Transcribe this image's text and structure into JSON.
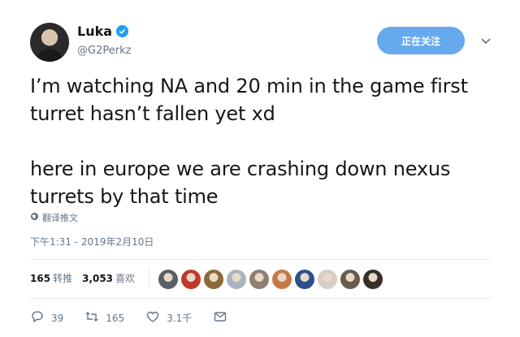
{
  "author": {
    "display_name": "Luka",
    "handle": "@G2Perkz"
  },
  "follow_button_label": "正在关注",
  "tweet": {
    "paragraphs": [
      "I’m watching NA and 20 min in the game first turret hasn’t fallen yet xd",
      "here in europe we are crashing down nexus turrets by that time"
    ],
    "translate_label": "翻译推文",
    "timestamp": "下午1:31 - 2019年2月10日"
  },
  "stats": {
    "retweets_count": "165",
    "retweets_label": "转推",
    "likes_count": "3,053",
    "likes_label": "喜欢"
  },
  "liker_avatars": [
    {
      "color": "#5a5f66"
    },
    {
      "color": "#c0392b"
    },
    {
      "color": "#8a6a3a"
    },
    {
      "color": "#aab4be"
    },
    {
      "color": "#8e7f72"
    },
    {
      "color": "#c47a45"
    },
    {
      "color": "#2f4f8a"
    },
    {
      "color": "#d6cfc6"
    },
    {
      "color": "#6b5a4e"
    },
    {
      "color": "#3a2e2a"
    }
  ],
  "actions": {
    "reply_count": "39",
    "retweet_count": "165",
    "like_count": "3.1千"
  },
  "colors": {
    "accent": "#1da1f2",
    "follow_button": "#67a9ee",
    "muted_text": "#657786"
  },
  "icons": [
    "verified-icon",
    "chevron-down-icon",
    "globe-icon",
    "reply-icon",
    "retweet-icon",
    "heart-icon",
    "message-icon"
  ]
}
